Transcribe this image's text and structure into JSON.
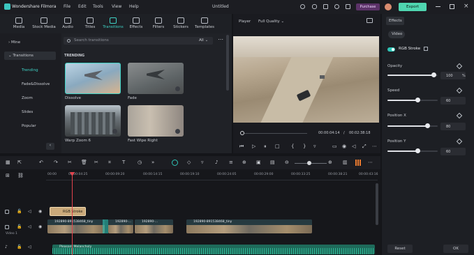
{
  "app": {
    "name": "Wondershare Filmora",
    "title": "Untitled",
    "menu": [
      "File",
      "Edit",
      "Tools",
      "View",
      "Help"
    ],
    "purchase": "Purchase",
    "export": "Export"
  },
  "toolbar": {
    "tabs": [
      {
        "label": "Media",
        "icon": "media-icon"
      },
      {
        "label": "Stock Media",
        "icon": "stock-media-icon"
      },
      {
        "label": "Audio",
        "icon": "audio-icon"
      },
      {
        "label": "Titles",
        "icon": "titles-icon"
      },
      {
        "label": "Transitions",
        "icon": "transitions-icon",
        "active": true
      },
      {
        "label": "Effects",
        "icon": "effects-icon"
      },
      {
        "label": "Filters",
        "icon": "filters-icon"
      },
      {
        "label": "Stickers",
        "icon": "stickers-icon"
      },
      {
        "label": "Templates",
        "icon": "templates-icon"
      }
    ]
  },
  "sidebar": {
    "items": [
      "Mine",
      "Transitions",
      "Trending",
      "Fade&Dissolve",
      "Zoom",
      "Slides",
      "Popular"
    ]
  },
  "browser": {
    "search_placeholder": "Search transitions",
    "filter": "All",
    "section": "TRENDING",
    "thumbs": [
      "Dissolve",
      "Fade",
      "Warp Zoom 6",
      "Fast Wipe Right"
    ]
  },
  "player": {
    "label": "Player",
    "quality": "Full Quality",
    "current": "00:00:04:14",
    "total": "00:02:38:18"
  },
  "effects": {
    "tab": "Effects",
    "subtab": "Video",
    "name": "RGB Stroke",
    "params": [
      {
        "label": "Opacity",
        "value": "100",
        "unit": "%",
        "level": 0.93
      },
      {
        "label": "Speed",
        "value": "60",
        "level": 0.6
      },
      {
        "label": "Position X",
        "value": "80",
        "level": 0.8
      },
      {
        "label": "Position Y",
        "value": "60",
        "level": 0.6
      }
    ],
    "reset": "Reset",
    "ok": "OK"
  },
  "timeline": {
    "ticks": [
      "00:00",
      "00:00:04:25",
      "00:00:09:20",
      "00:00:14:15",
      "00:00:19:10",
      "00:00:24:05",
      "00:00:29:00",
      "00:00:33:25",
      "00:00:38:21",
      "00:00:43:16"
    ],
    "effect_clip": "RGB Stroke",
    "clips": [
      "192890-891538468_tiny",
      "192890-...",
      "192890-...",
      "192890-891538468_tiny"
    ],
    "track_label": "Video 1",
    "audio_clip": "Pleasant Melancholy"
  },
  "colors": {
    "accent": "#2ec4b6",
    "purchase": "#6a3b7a",
    "export": "#4fd5b0",
    "playhead": "#e2434d"
  }
}
